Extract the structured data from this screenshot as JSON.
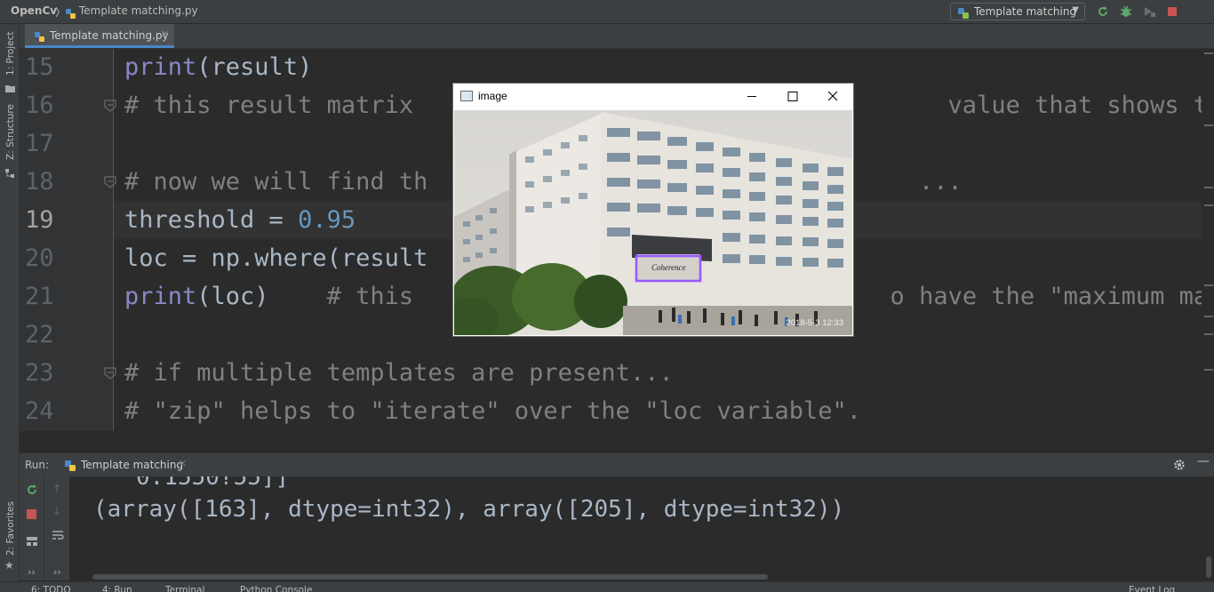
{
  "navbar": {
    "project": "OpenCv",
    "separator": "〉",
    "file": "Template matching.py",
    "run_config": "Template matching"
  },
  "left_strip": {
    "project_label": "1: Project",
    "structure_label": "Z: Structure",
    "favorites_label": "2: Favorites"
  },
  "editor": {
    "tab_label": "Template matching.py",
    "lines": [
      {
        "n": "15",
        "segments": [
          {
            "t": "print",
            "c": "kw"
          },
          {
            "t": "(result)",
            "c": ""
          }
        ]
      },
      {
        "n": "16",
        "segments": [
          {
            "t": "# this result matrix                                     value that shows the br",
            "c": "cm"
          }
        ]
      },
      {
        "n": "17",
        "segments": []
      },
      {
        "n": "18",
        "segments": [
          {
            "t": "# now we will find th                                  ...",
            "c": "cm"
          }
        ]
      },
      {
        "n": "19",
        "segments": [
          {
            "t": "threshold = ",
            "c": ""
          },
          {
            "t": "0.95",
            "c": "num"
          }
        ]
      },
      {
        "n": "20",
        "segments": [
          {
            "t": "loc = np.where(result",
            "c": ""
          }
        ]
      },
      {
        "n": "21",
        "segments": [
          {
            "t": "print",
            "c": "kw"
          },
          {
            "t": "(loc)    ",
            "c": ""
          },
          {
            "t": "# this                                 o have the \"maximum mat",
            "c": "cm"
          }
        ]
      },
      {
        "n": "22",
        "segments": []
      },
      {
        "n": "23",
        "segments": [
          {
            "t": "# if multiple templates are present...",
            "c": "cm"
          }
        ]
      },
      {
        "n": "24",
        "segments": [
          {
            "t": "# \"zip\" helps to \"iterate\" over the \"loc variable\".",
            "c": "cm"
          }
        ]
      }
    ]
  },
  "image_window": {
    "title": "image",
    "stamp": "2018-5-3 12:33",
    "sign_text": "Coherence"
  },
  "run": {
    "label": "Run:",
    "tab_label": "Template matching",
    "partial_line": "0.1550?55]]",
    "output": "(array([163], dtype=int32), array([205], dtype=int32))"
  },
  "bottom": {
    "todo": "6: TODO",
    "run": "4: Run",
    "terminal": "Terminal",
    "python_console": "Python Console",
    "event_log": "Event Log"
  }
}
